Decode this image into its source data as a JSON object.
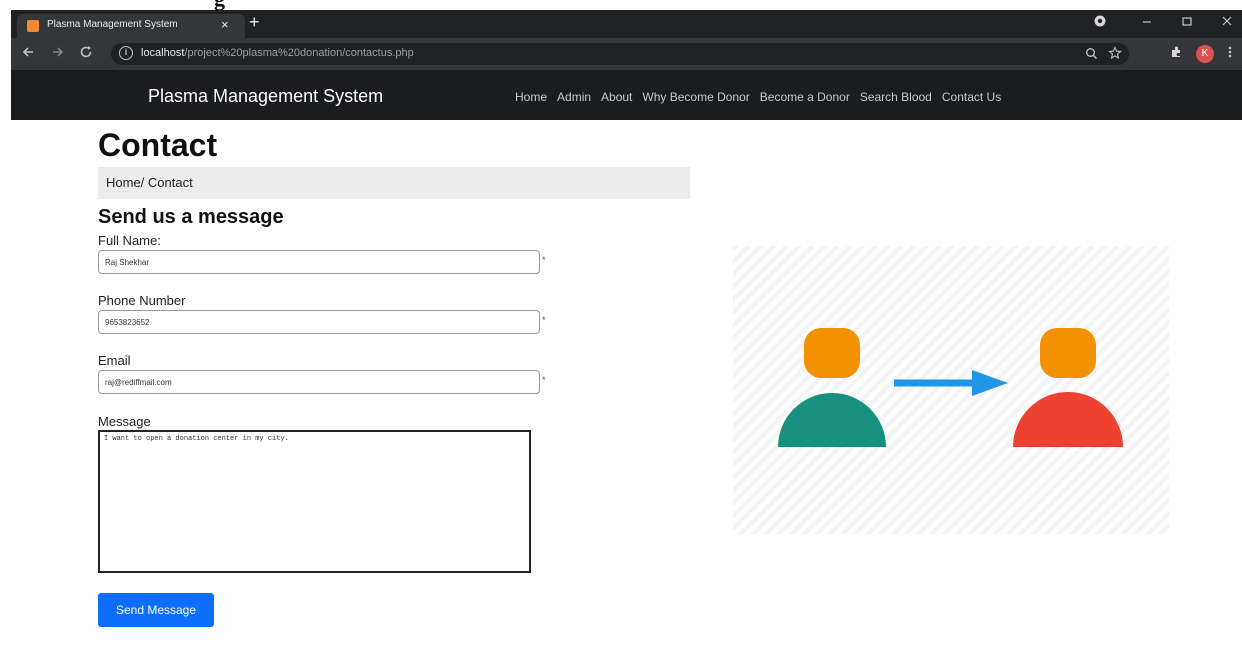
{
  "page_fragment": {
    "cut_text": "g"
  },
  "browser": {
    "tab_title": "Plasma Management System",
    "tab_close": "×",
    "new_tab": "+",
    "url_host": "localhost",
    "url_path": "/project%20plasma%20donation/contactus.php",
    "profile_initial": "K",
    "icons": [
      "back-icon",
      "forward-icon",
      "reload-icon",
      "info-icon",
      "zoom-icon",
      "bookmark-star-icon",
      "extensions-icon",
      "menu-icon",
      "minimize-icon",
      "maximize-icon",
      "close-icon"
    ]
  },
  "navbar": {
    "brand": "Plasma Management System",
    "links": [
      "Home",
      "Admin",
      "About",
      "Why Become Donor",
      "Become a Donor",
      "Search Blood",
      "Contact Us"
    ]
  },
  "page": {
    "title": "Contact",
    "breadcrumb": "Home/ Contact"
  },
  "form": {
    "heading": "Send us a message",
    "fields": [
      {
        "label": "Full Name:",
        "value": "Raj Shekhar"
      },
      {
        "label": "Phone Number",
        "value": "9653823652"
      },
      {
        "label": "Email",
        "value": "raj@rediffmail.com"
      }
    ],
    "message_label": "Message",
    "message_value": "I want to open a donation center in my city.",
    "required_mark": "*",
    "submit_label": "Send Message"
  },
  "colors": {
    "primary_button": "#0d6efd",
    "navbar_bg": "#1b1c1f",
    "person_head": "#f39200",
    "person_left_body": "#17907f",
    "person_right_body": "#ef4130",
    "arrow": "#2196e6"
  }
}
